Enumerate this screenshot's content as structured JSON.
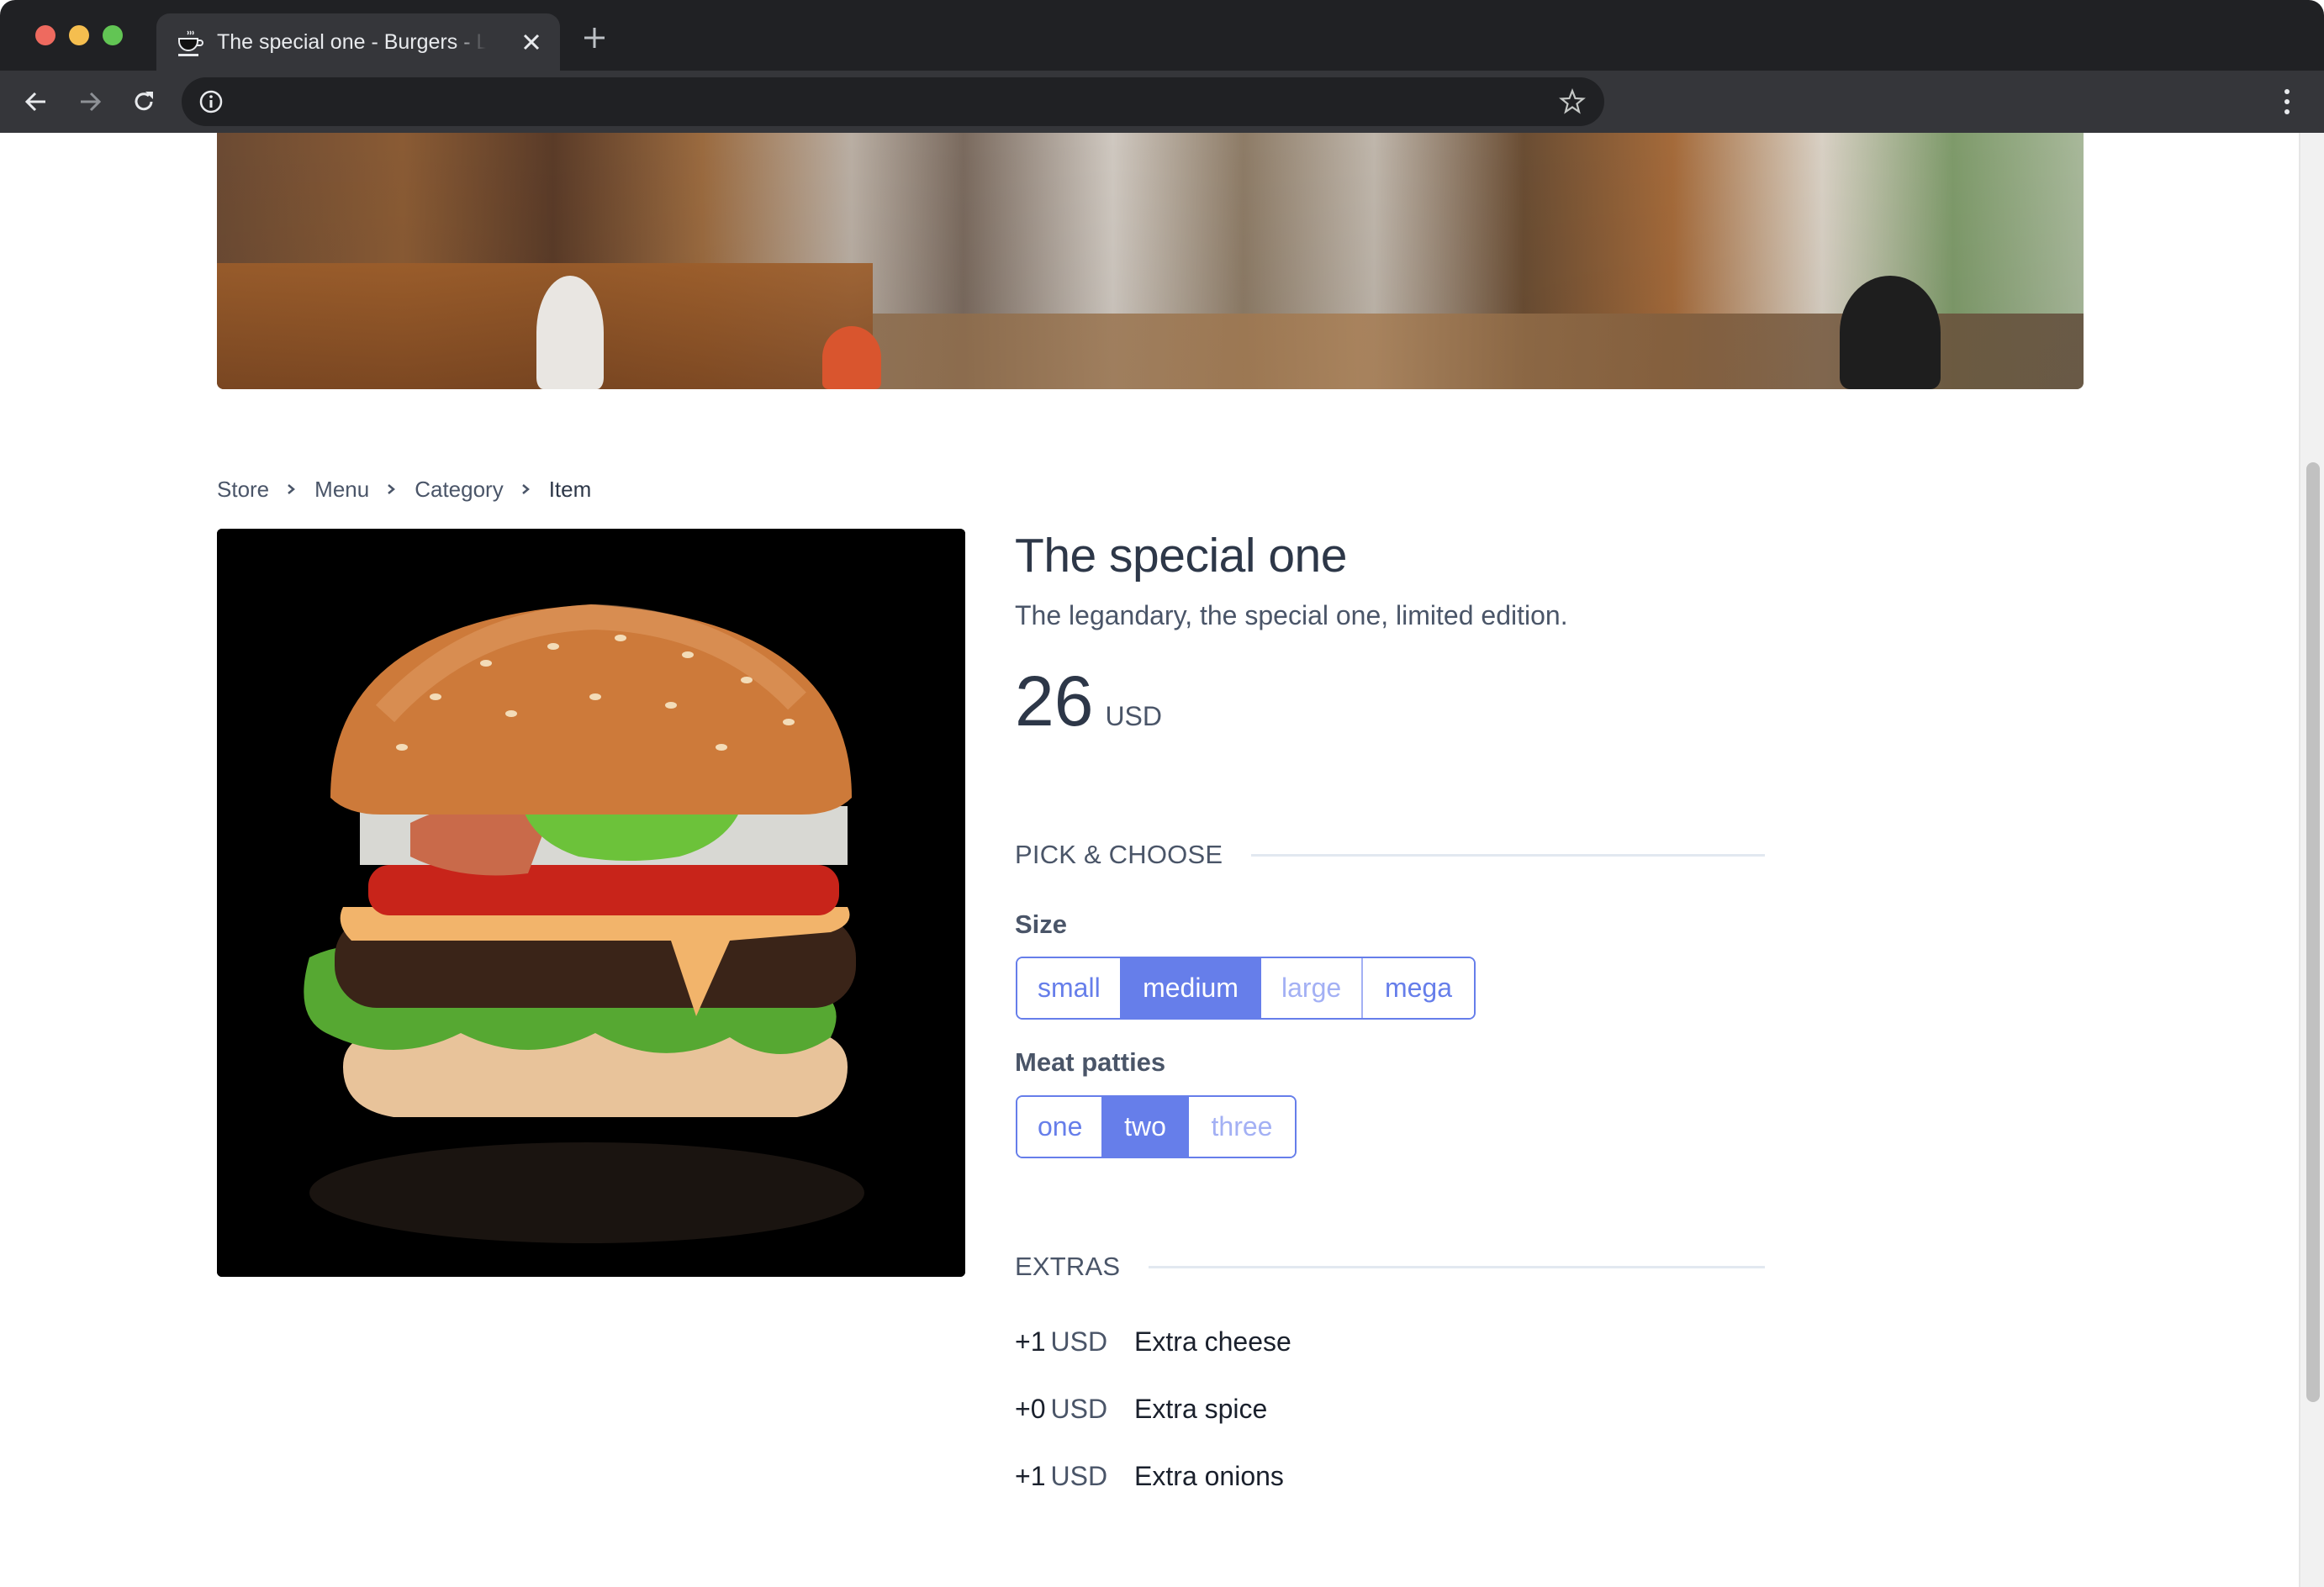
{
  "browser": {
    "tab": {
      "title": "The special one - Burgers - Lunch",
      "icon": "coffee-cup-icon"
    },
    "new_tab_icon": "plus-icon",
    "nav": {
      "back_icon": "arrow-left-icon",
      "forward_icon": "arrow-right-icon",
      "reload_icon": "reload-icon"
    },
    "address": {
      "value": "",
      "info_icon": "info-icon",
      "bookmark_icon": "star-icon"
    },
    "menu_icon": "kebab-menu-icon"
  },
  "breadcrumb": [
    {
      "label": "Store"
    },
    {
      "label": "Menu"
    },
    {
      "label": "Category"
    },
    {
      "label": "Item"
    }
  ],
  "product": {
    "image_alt": "Burger with sesame bun, lettuce, bacon, tomato, cheese and beef patty",
    "title": "The special one",
    "description": "The legandary, the special one, limited edition.",
    "price": "26",
    "currency": "USD"
  },
  "pick_and_choose": {
    "heading": "PICK & CHOOSE",
    "size": {
      "label": "Size",
      "options": [
        {
          "label": "small",
          "state": "available"
        },
        {
          "label": "medium",
          "state": "selected"
        },
        {
          "label": "large",
          "state": "disabled"
        },
        {
          "label": "mega",
          "state": "available"
        }
      ]
    },
    "meat_patties": {
      "label": "Meat patties",
      "options": [
        {
          "label": "one",
          "state": "available"
        },
        {
          "label": "two",
          "state": "selected"
        },
        {
          "label": "three",
          "state": "disabled"
        }
      ]
    }
  },
  "extras": {
    "heading": "EXTRAS",
    "items": [
      {
        "amount": "+1",
        "currency": "USD",
        "name": "Extra cheese"
      },
      {
        "amount": "+0",
        "currency": "USD",
        "name": "Extra spice"
      },
      {
        "amount": "+1",
        "currency": "USD",
        "name": "Extra onions"
      }
    ]
  },
  "colors": {
    "accent": "#667eea",
    "accent_disabled": "#a3b0f4",
    "text_dark": "#2d3748",
    "text_muted": "#4a5568",
    "divider": "#e2e8f0"
  }
}
